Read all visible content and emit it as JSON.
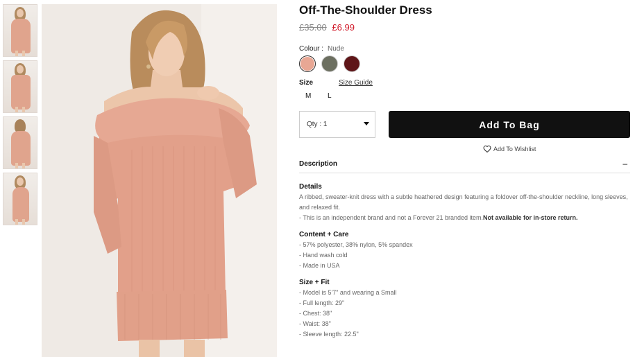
{
  "thumbnails": [
    {
      "label": "Thumbnail 1"
    },
    {
      "label": "Thumbnail 2"
    },
    {
      "label": "Thumbnail 3"
    },
    {
      "label": "Thumbnail 4"
    }
  ],
  "product": {
    "title": "Off-The-Shoulder Dress",
    "original_price": "£35.00",
    "sale_price": "£6.99"
  },
  "colour": {
    "label": "Colour :",
    "selected": "Nude",
    "swatches": [
      {
        "name": "nude",
        "color": "#e8a794"
      },
      {
        "name": "olive",
        "color": "#6c6f60"
      },
      {
        "name": "burgundy",
        "color": "#5e1518"
      }
    ]
  },
  "size": {
    "label": "Size",
    "guide_link": "Size Guide",
    "options": [
      "M",
      "L"
    ]
  },
  "purchase": {
    "qty_text": "Qty : 1",
    "add_to_bag": "Add To Bag",
    "wishlist": "Add To Wishlist"
  },
  "description": {
    "heading": "Description",
    "toggle": "–",
    "details_title": "Details",
    "details_text": "A ribbed, sweater-knit dress with a subtle heathered design featuring a foldover off-the-shoulder neckline, long sleeves, and relaxed fit.",
    "details_note": "- This is an independent brand and not a Forever 21 branded item.",
    "details_note_bold": "Not available for in-store return.",
    "content_title": "Content + Care",
    "content_lines": [
      "- 57% polyester, 38% nylon, 5% spandex",
      "- Hand wash cold",
      "- Made in USA"
    ],
    "fit_title": "Size + Fit",
    "fit_lines": [
      "- Model is 5'7\" and wearing a Small",
      "- Full length: 29\"",
      "- Chest: 38\"",
      "- Waist: 38\"",
      "- Sleeve length: 22.5\""
    ]
  }
}
